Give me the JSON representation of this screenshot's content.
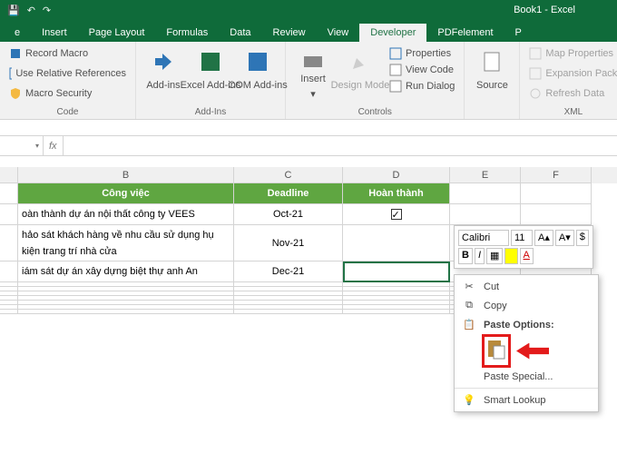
{
  "title": "Book1 - Excel",
  "tabs": [
    "e",
    "Insert",
    "Page Layout",
    "Formulas",
    "Data",
    "Review",
    "View",
    "Developer",
    "PDFelement",
    "P"
  ],
  "activeTab": "Developer",
  "ribbon": {
    "code": {
      "label": "Code",
      "items": [
        "Record Macro",
        "Use Relative References",
        "Macro Security"
      ]
    },
    "addins": {
      "label": "Add-Ins",
      "items": [
        "Add-ins",
        "Excel Add-ins",
        "COM Add-ins"
      ]
    },
    "controls": {
      "label": "Controls",
      "insert": "Insert",
      "design": "Design Mode",
      "props": "Properties",
      "view": "View Code",
      "run": "Run Dialog"
    },
    "source": {
      "label": "Source"
    },
    "xml": {
      "label": "XML",
      "items": [
        "Map Properties",
        "Expansion Pack",
        "Refresh Data"
      ]
    }
  },
  "fx": "fx",
  "dropdown": "▾",
  "cols": [
    "B",
    "C",
    "D",
    "E",
    "F"
  ],
  "headers": {
    "b": "Công việc",
    "c": "Deadline",
    "d": "Hoàn thành"
  },
  "rows": [
    {
      "b": "oàn thành dự án nội thất công ty VEES",
      "c": "Oct-21",
      "checked": true
    },
    {
      "b": "hảo sát khách hàng về nhu cầu sử dụng hụ kiện trang trí nhà cửa",
      "c": "Nov-21"
    },
    {
      "b": "iám sát dự án xây dựng biệt thự anh An",
      "c": "Dec-21"
    }
  ],
  "minibar": {
    "font": "Calibri",
    "size": "11",
    "b": "B",
    "i": "I"
  },
  "ctx": {
    "cut": "Cut",
    "copy": "Copy",
    "pasteopt": "Paste Options:",
    "pastespecial": "Paste Special...",
    "smart": "Smart Lookup"
  }
}
